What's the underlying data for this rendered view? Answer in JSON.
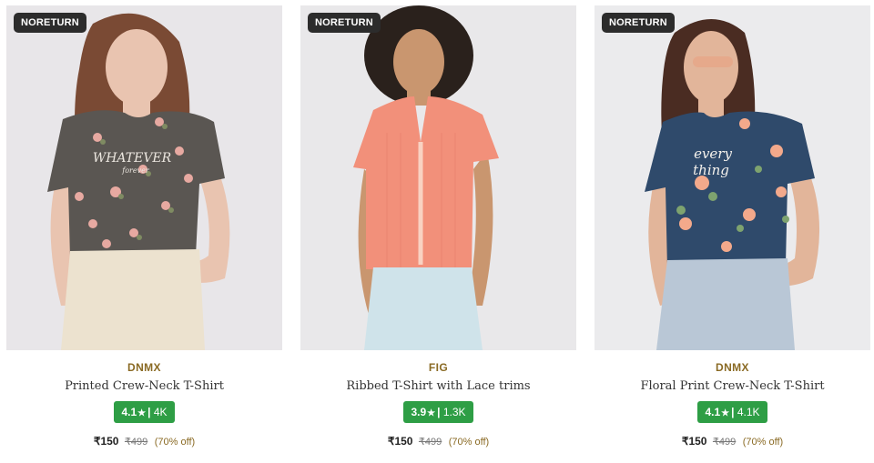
{
  "products": [
    {
      "badge": "NORETURN",
      "brand": "DNMX",
      "name": "Printed Crew-Neck T-Shirt",
      "rating": "4.1",
      "reviews": "4K",
      "price": "₹150",
      "mrp": "₹499",
      "discount": "(70% off)",
      "colors": {
        "bg": "#e8e6e9",
        "top": "#5a5652",
        "bottom": "#ece2cf",
        "hair": "#7a4a34",
        "skin": "#e9c4b0"
      },
      "print_text_1": "WHATEVER",
      "print_text_2": "forever"
    },
    {
      "badge": "NORETURN",
      "brand": "FIG",
      "name": "Ribbed T-Shirt with Lace trims",
      "rating": "3.9",
      "reviews": "1.3K",
      "price": "₹150",
      "mrp": "₹499",
      "discount": "(70% off)",
      "colors": {
        "bg": "#e9e8ea",
        "top": "#f2907a",
        "bottom": "#cfe3ea",
        "hair": "#2a211c",
        "skin": "#c9966f"
      }
    },
    {
      "badge": "NORETURN",
      "brand": "DNMX",
      "name": "Floral Print Crew-Neck T-Shirt",
      "rating": "4.1",
      "reviews": "4.1K",
      "price": "₹150",
      "mrp": "₹499",
      "discount": "(70% off)",
      "colors": {
        "bg": "#ebebed",
        "top": "#2f4a6b",
        "bottom": "#b9c7d6",
        "hair": "#4a2c22",
        "skin": "#e2b59a"
      },
      "print_text_1": "every",
      "print_text_2": "thing"
    }
  ],
  "rating_star": "★",
  "rating_sep": "|"
}
